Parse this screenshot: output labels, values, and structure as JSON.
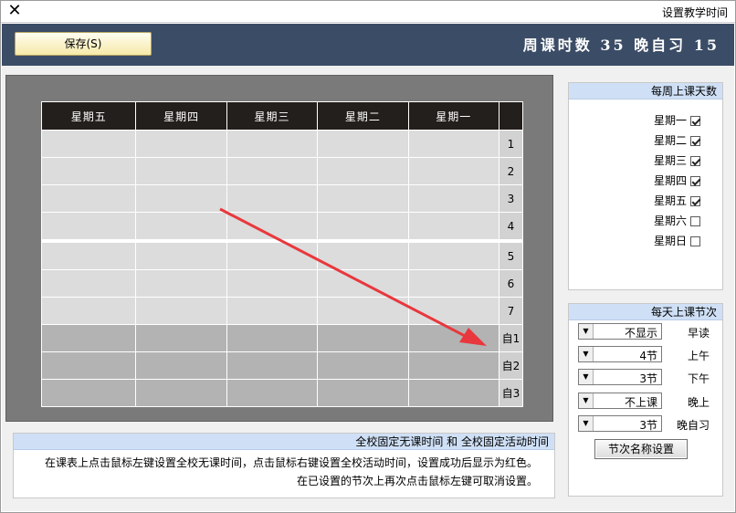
{
  "window": {
    "title": "设置教学时间",
    "close_glyph": "✕"
  },
  "header": {
    "save_label": "保存(S)",
    "summary": "周课时数 35 晚自习 15"
  },
  "schedule": {
    "days": [
      "星期五",
      "星期四",
      "星期三",
      "星期二",
      "星期一"
    ],
    "rows": [
      "1",
      "2",
      "3",
      "4",
      "5",
      "6",
      "7",
      "自1",
      "自2",
      "自3"
    ]
  },
  "days_per_week": {
    "title": "每周上课天数",
    "items": [
      {
        "label": "星期一",
        "checked": true
      },
      {
        "label": "星期二",
        "checked": true
      },
      {
        "label": "星期三",
        "checked": true
      },
      {
        "label": "星期四",
        "checked": true
      },
      {
        "label": "星期五",
        "checked": true
      },
      {
        "label": "星期六",
        "checked": false
      },
      {
        "label": "星期日",
        "checked": false
      }
    ]
  },
  "sessions": {
    "title": "每天上课节次",
    "items": [
      {
        "label": "早读",
        "value": "不显示"
      },
      {
        "label": "上午",
        "value": "4节"
      },
      {
        "label": "下午",
        "value": "3节"
      },
      {
        "label": "晚上",
        "value": "不上课"
      },
      {
        "label": "晚自习",
        "value": "3节"
      }
    ],
    "rename_button": "节次名称设置"
  },
  "note": {
    "title": "全校固定无课时间 和 全校固定活动时间",
    "line1": "在课表上点击鼠标左键设置全校无课时间，点击鼠标右键设置全校活动时间，设置成功后显示为红色。",
    "line2": "在已设置的节次上再次点击鼠标左键可取消设置。"
  },
  "colors": {
    "header_bg": "#3b4c66",
    "arrow": "#e8383d",
    "panel_head": "#cfe0f6"
  }
}
